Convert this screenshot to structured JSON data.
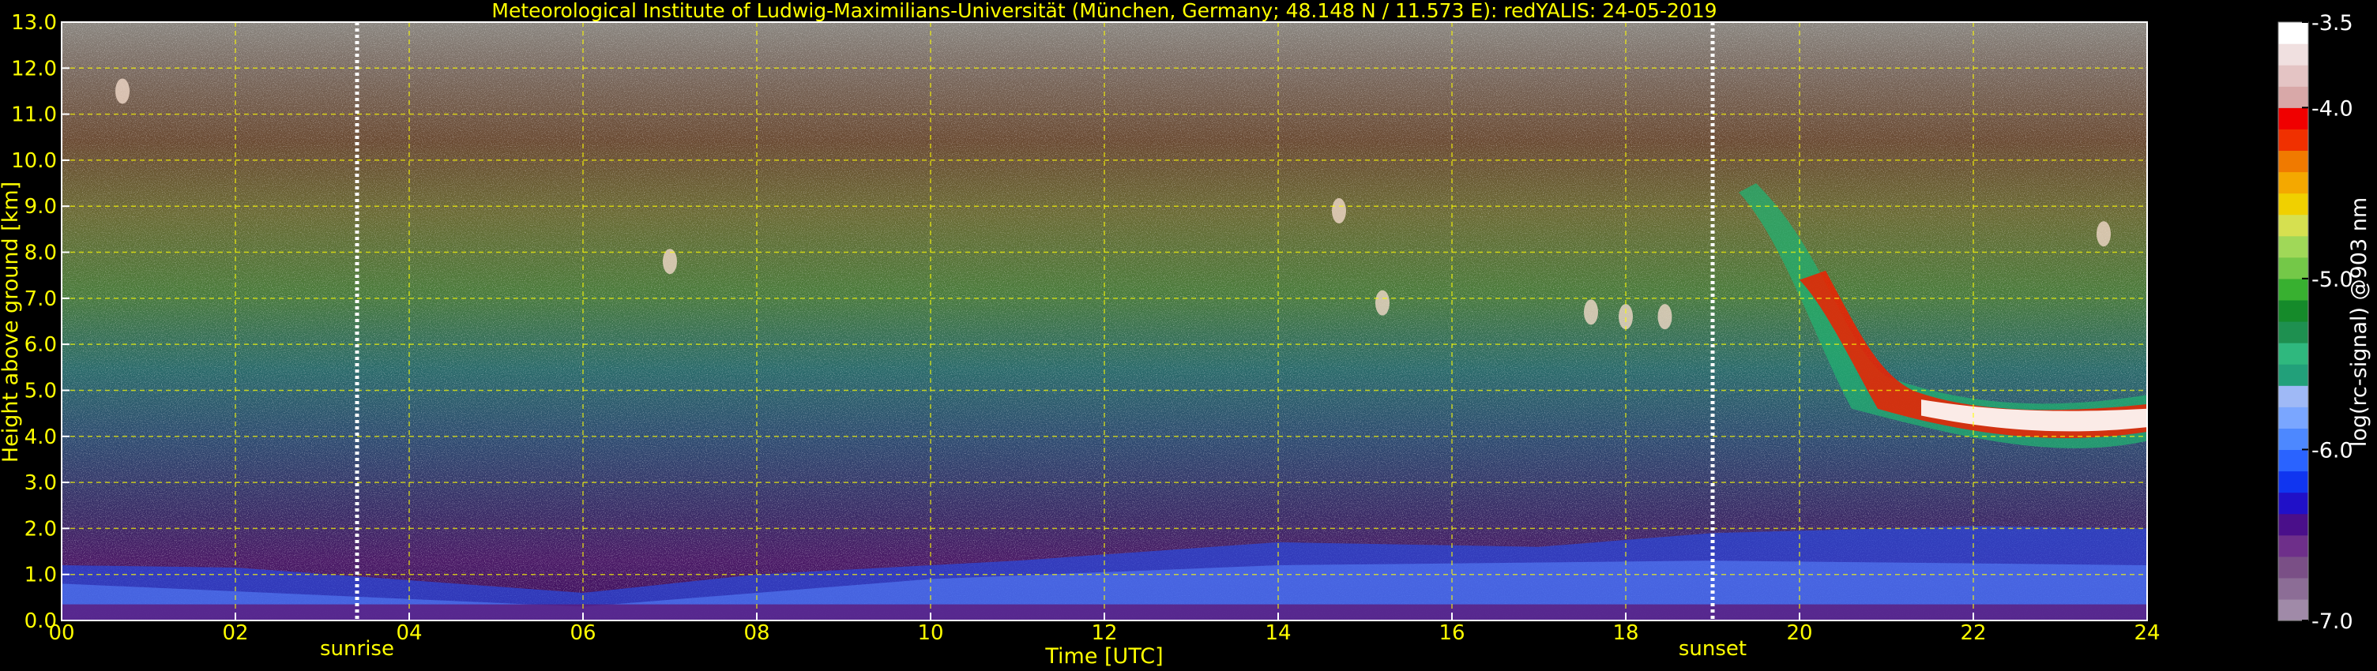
{
  "chart_data": {
    "type": "heatmap",
    "title": "Meteorological Institute of Ludwig-Maximilians-Universität (München, Germany; 48.148 N / 11.573 E):    redYALIS: 24-05-2019",
    "xlabel": "Time [UTC]",
    "ylabel": "Height above ground [km]",
    "xlim": [
      0,
      24
    ],
    "ylim": [
      0,
      13
    ],
    "x_ticks": [
      0,
      2,
      4,
      6,
      8,
      10,
      12,
      14,
      16,
      18,
      20,
      22,
      24
    ],
    "x_tick_labels": [
      "00",
      "02",
      "04",
      "06",
      "08",
      "10",
      "12",
      "14",
      "16",
      "18",
      "20",
      "22",
      "24"
    ],
    "y_ticks": [
      0,
      1,
      2,
      3,
      4,
      5,
      6,
      7,
      8,
      9,
      10,
      11,
      12,
      13
    ],
    "y_tick_labels": [
      "0.0",
      "1.0",
      "2.0",
      "3.0",
      "4.0",
      "5.0",
      "6.0",
      "7.0",
      "8.0",
      "9.0",
      "10.0",
      "11.0",
      "12.0",
      "13.0"
    ],
    "grid": true,
    "annotations": [
      {
        "label": "sunrise",
        "x": 3.4
      },
      {
        "label": "sunset",
        "x": 19.0
      }
    ],
    "colorbar": {
      "label": "log(rc-signal) @903 nm",
      "range": [
        -7.0,
        -3.5
      ],
      "ticks": [
        -3.5,
        -4.0,
        -5.0,
        -6.0,
        -7.0
      ],
      "tick_labels": [
        "-3.5",
        "-4.0",
        "-5.0",
        "-6.0",
        "-7.0"
      ],
      "colors": [
        "#a08aa8",
        "#8c6d96",
        "#7a4f86",
        "#6e2f8a",
        "#4a0f8a",
        "#2010c8",
        "#1035f0",
        "#2a63ff",
        "#4d88ff",
        "#7aa6ff",
        "#9fb9f6",
        "#22a07a",
        "#2fb87e",
        "#1e9050",
        "#158a2a",
        "#38b030",
        "#74c848",
        "#a0d858",
        "#d6e050",
        "#f0d000",
        "#f4a800",
        "#f07a00",
        "#f03000",
        "#f00000",
        "#d8a8a8",
        "#e4c4c4",
        "#f0e0e0",
        "#ffffff"
      ]
    },
    "colors": {
      "text": "#ffff00",
      "grid": "#ffff00",
      "axis": "#ffffff",
      "background": "#000000"
    }
  }
}
